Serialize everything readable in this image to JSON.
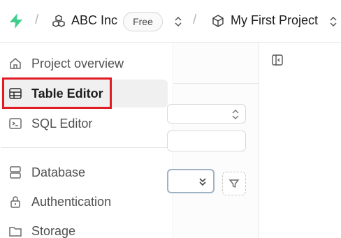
{
  "breadcrumb": {
    "logo_icon": "supabase-logo-icon",
    "separator": "/",
    "organization": {
      "icon": "boxes-icon",
      "name": "ABC Inc",
      "plan": "Free"
    },
    "project": {
      "icon": "box-icon",
      "name": "My First Project"
    },
    "switcher_icon": "chevrons-up-down-icon"
  },
  "sidebar": {
    "items": [
      {
        "label": "Project overview",
        "icon": "home-icon",
        "active": false
      },
      {
        "label": "Table Editor",
        "icon": "table-icon",
        "active": true
      },
      {
        "label": "SQL Editor",
        "icon": "terminal-icon",
        "active": false
      },
      {
        "label": "Database",
        "icon": "database-icon",
        "active": false
      },
      {
        "label": "Authentication",
        "icon": "lock-icon",
        "active": false
      },
      {
        "label": "Storage",
        "icon": "folder-icon",
        "active": false
      }
    ]
  },
  "annotation": {
    "highlight_color": "#e01b24"
  },
  "colors": {
    "brand": "#3ecf8e"
  }
}
